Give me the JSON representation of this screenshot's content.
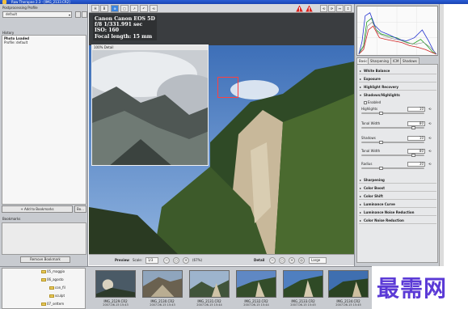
{
  "window": {
    "title": "Raw Therapee 2.3 - [IMG_2133.CR2]"
  },
  "left_panel": {
    "profile_label": "Postprocessing Profile",
    "profile_value": "default",
    "history_label": "History",
    "history_items": [
      {
        "title": "Photo Loaded",
        "sub": "Profile: default"
      }
    ],
    "add_bookmark_label": "Add to Bookmarks",
    "bookmark_small_btn": "Bo...",
    "bookmarks_label": "Bookmarks",
    "remove_bookmark_label": "Remove Bookmark"
  },
  "toolbar": {
    "buttons": [
      "H",
      "B",
      "▲ V",
      "⊕",
      "□",
      "↗",
      "↶",
      "⟲"
    ],
    "right_buttons": [
      "⟲",
      "⟳",
      "↔",
      "↕"
    ]
  },
  "preview": {
    "exif_lines": [
      "Canon Canon EOS 5D",
      "f/8 1/331.991 sec",
      "ISO: 160",
      "Focal length: 15 mm"
    ],
    "detail_title": "100% Detail"
  },
  "zoombar": {
    "preview_label": "Preview",
    "scale_label": "Scale:",
    "scale_value": "1/3",
    "zoom_value": "(67%)",
    "detail_label": "Detail",
    "detail_size": "Large"
  },
  "right_panel": {
    "tabs": [
      "Basic",
      "Sharpening",
      "ICM",
      "Shadows"
    ],
    "tools_top": [
      {
        "label": "White Balance"
      },
      {
        "label": "Exposure"
      },
      {
        "label": "Highlight Recovery"
      },
      {
        "label": "Shadows/Highlights"
      }
    ],
    "enabled_label": "Enabled",
    "params": [
      {
        "label": "Highlights",
        "value": "10",
        "level": 0.3
      },
      {
        "label": "Tonal Width",
        "value": "80",
        "level": 0.85
      },
      {
        "label": "Shadows",
        "value": "10",
        "level": 0.3
      },
      {
        "label": "Tonal Width",
        "value": "80",
        "level": 0.85
      },
      {
        "label": "Radius",
        "value": "30",
        "level": 0.3
      }
    ],
    "tools_bottom": [
      {
        "label": "Sharpening"
      },
      {
        "label": "Color Boost"
      },
      {
        "label": "Color Shift"
      },
      {
        "label": "Luminance Curve"
      },
      {
        "label": "Luminance Noise Reduction"
      },
      {
        "label": "Color Noise Reduction"
      }
    ]
  },
  "filmstrip": {
    "tree_items": [
      {
        "label": "05_maggio",
        "depth": 1
      },
      {
        "label": "06_agosto",
        "depth": 1
      },
      {
        "label": "con_fil",
        "depth": 2
      },
      {
        "label": "sculpt",
        "depth": 2
      },
      {
        "label": "07_settem",
        "depth": 1
      }
    ],
    "thumbs": [
      {
        "name": "IMG_2129.CR2",
        "date": "2007-06-15 15:43"
      },
      {
        "name": "IMG_2130.CR2",
        "date": "2007-06-15 15:43"
      },
      {
        "name": "IMG_2131.CR2",
        "date": "2007-06-15 15:44"
      },
      {
        "name": "IMG_2132.CR2",
        "date": "2007-06-15 15:44"
      },
      {
        "name": "IMG_2133.CR2",
        "date": "2007-06-15 15:45"
      },
      {
        "name": "IMG_2134.CR2",
        "date": "2007-06-15 15:45"
      }
    ]
  },
  "watermark_text": "最需网",
  "colors": {
    "accent": "#3d86e0",
    "panel": "#c8cbd0",
    "focus": "#ff4040",
    "watermark": "#5b3ad6"
  }
}
